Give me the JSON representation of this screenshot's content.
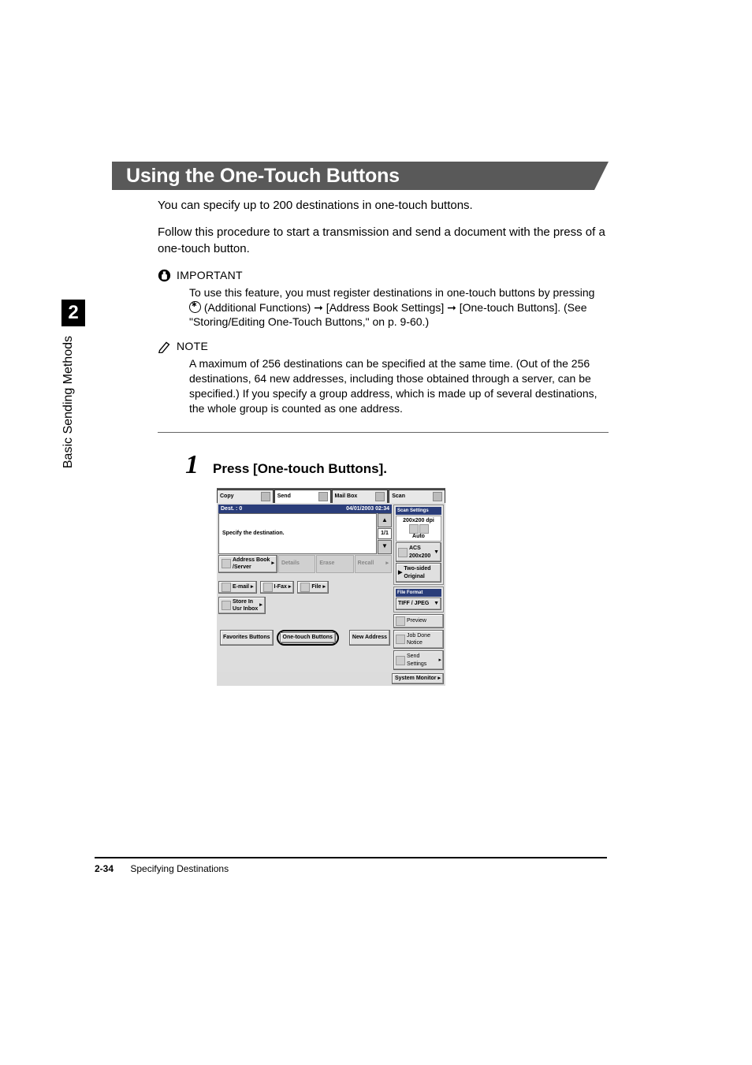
{
  "chapter": "2",
  "section_name": "Basic Sending Methods",
  "banner_title": "Using the One-Touch Buttons",
  "intro1": "You can specify up to 200 destinations in one-touch buttons.",
  "intro2": "Follow this procedure to start a transmission and send a document with the press of a one-touch button.",
  "important": {
    "label": "IMPORTANT",
    "text_a": "To use this feature, you must register destinations in one-touch buttons by pressing ",
    "text_b": " (Additional Functions) ➞ [Address Book Settings] ➞ [One-touch Buttons]. (See \"Storing/Editing One-Touch Buttons,\" on p. 9-60.)"
  },
  "note": {
    "label": "NOTE",
    "text": "A maximum of 256 destinations can be specified at the same time. (Out of the 256 destinations, 64 new addresses, including those obtained through a server, can be specified.) If you specify a group address, which is made up of several destinations, the whole group is counted as one address."
  },
  "step": {
    "num": "1",
    "title": "Press [One-touch Buttons]."
  },
  "screenshot": {
    "tabs": {
      "copy": "Copy",
      "send": "Send",
      "mailbox": "Mail Box",
      "scan": "Scan"
    },
    "status_left": "Dest. :    0",
    "status_right": "04/01/2003  02:34",
    "specify": "Specify the destination.",
    "page": "1/1",
    "address_book": "Address Book\n/Server",
    "details": "Details",
    "erase": "Erase",
    "recall": "Recall",
    "email": "E-mail",
    "ifax": "I-Fax",
    "file": "File",
    "store": "Store In\nUsr Inbox",
    "favorites": "Favorites Buttons",
    "onetouch": "One-touch Buttons",
    "newaddress": "New Address",
    "scan_settings": "Scan Settings",
    "dpi": "200x200 dpi",
    "auto": "Auto",
    "acs": "ACS\n200x200",
    "twosided": "Two-sided\nOriginal",
    "fileformat_label": "File Format",
    "fileformat": "TIFF / JPEG",
    "preview": "Preview",
    "jobdone": "Job Done\nNotice",
    "sendsettings": "Send\nSettings",
    "sysmon": "System Monitor"
  },
  "footer": {
    "page": "2-34",
    "title": "Specifying Destinations"
  }
}
